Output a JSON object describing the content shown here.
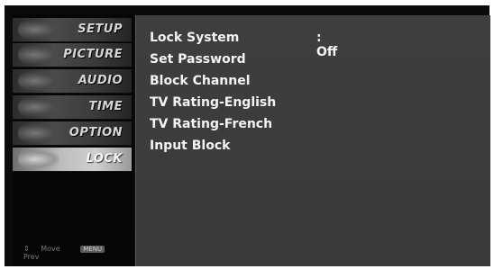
{
  "sidebar": {
    "items": [
      {
        "label": "SETUP"
      },
      {
        "label": "PICTURE"
      },
      {
        "label": "AUDIO"
      },
      {
        "label": "TIME"
      },
      {
        "label": "OPTION"
      },
      {
        "label": "LOCK",
        "selected": true
      }
    ],
    "hints": {
      "move_icon": "⇕",
      "move_label": "Move",
      "prev_key": "MENU",
      "prev_label": "Prev"
    }
  },
  "lock_menu": {
    "items": [
      {
        "label": "Lock System",
        "value": ": Off"
      },
      {
        "label": "Set Password"
      },
      {
        "label": "Block Channel"
      },
      {
        "label": "TV Rating-English"
      },
      {
        "label": "TV Rating-French"
      },
      {
        "label": "Input Block"
      }
    ]
  }
}
